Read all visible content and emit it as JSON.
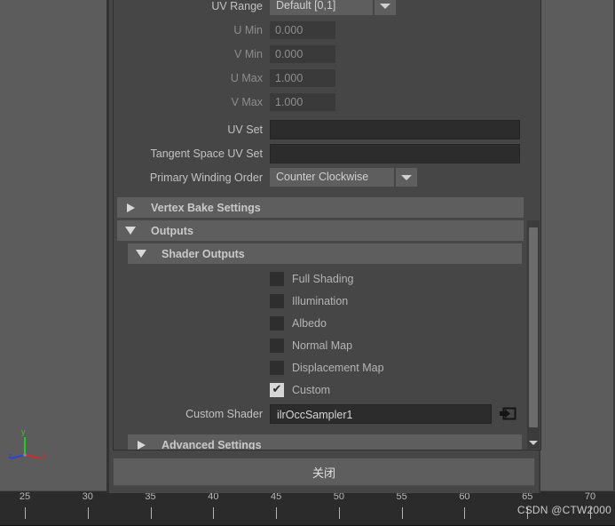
{
  "viewport": {
    "axis_gizmo": {
      "x_label": "x",
      "y_label": "y",
      "z_label": "z",
      "x_color": "#d42a2a",
      "y_color": "#22cc22",
      "z_color": "#2a45d4"
    }
  },
  "timeline": {
    "ticks": [
      25,
      30,
      35,
      40,
      45,
      50,
      55,
      60,
      65,
      70
    ],
    "watermark": "CSDN @CTW2000"
  },
  "dialog": {
    "attributes": [
      {
        "label": "UV Range",
        "type": "dropdown",
        "value": "Default [0,1]",
        "width": "uv"
      },
      {
        "label": "U Min",
        "type": "number",
        "value": "0.000",
        "disabled": true
      },
      {
        "label": "V Min",
        "type": "number",
        "value": "0.000",
        "disabled": true
      },
      {
        "label": "U Max",
        "type": "number",
        "value": "1.000",
        "disabled": true
      },
      {
        "label": "V Max",
        "type": "number",
        "value": "1.000",
        "disabled": true
      },
      {
        "label": "UV Set",
        "type": "text",
        "value": ""
      },
      {
        "label": "Tangent Space UV Set",
        "type": "text",
        "value": ""
      },
      {
        "label": "Primary Winding Order",
        "type": "dropdown",
        "value": "Counter Clockwise",
        "width": "wind"
      }
    ],
    "labels": {
      "uv_range": "UV Range",
      "u_min": "U Min",
      "v_min": "V Min",
      "u_max": "U Max",
      "v_max": "V Max",
      "uv_set": "UV Set",
      "tangent_space_uv_set": "Tangent Space UV Set",
      "primary_winding_order": "Primary Winding Order",
      "custom_shader": "Custom Shader"
    },
    "values": {
      "uv_range": "Default [0,1]",
      "u_min": "0.000",
      "v_min": "0.000",
      "u_max": "1.000",
      "v_max": "1.000",
      "uv_set": "",
      "tangent_space_uv_set": "",
      "primary_winding_order": "Counter Clockwise",
      "custom_shader": "ilrOccSampler1"
    },
    "sections": {
      "vertex_bake_settings": {
        "title": "Vertex Bake Settings",
        "expanded": false
      },
      "outputs": {
        "title": "Outputs",
        "expanded": true
      },
      "shader_outputs": {
        "title": "Shader Outputs",
        "expanded": true
      },
      "advanced_settings": {
        "title": "Advanced Settings",
        "expanded": false
      }
    },
    "shader_outputs": [
      {
        "label": "Full Shading",
        "checked": false
      },
      {
        "label": "Illumination",
        "checked": false
      },
      {
        "label": "Albedo",
        "checked": false
      },
      {
        "label": "Normal Map",
        "checked": false
      },
      {
        "label": "Displacement Map",
        "checked": false
      },
      {
        "label": "Custom",
        "checked": true
      }
    ],
    "check_glyph": "✔",
    "close_label": "关闭"
  }
}
